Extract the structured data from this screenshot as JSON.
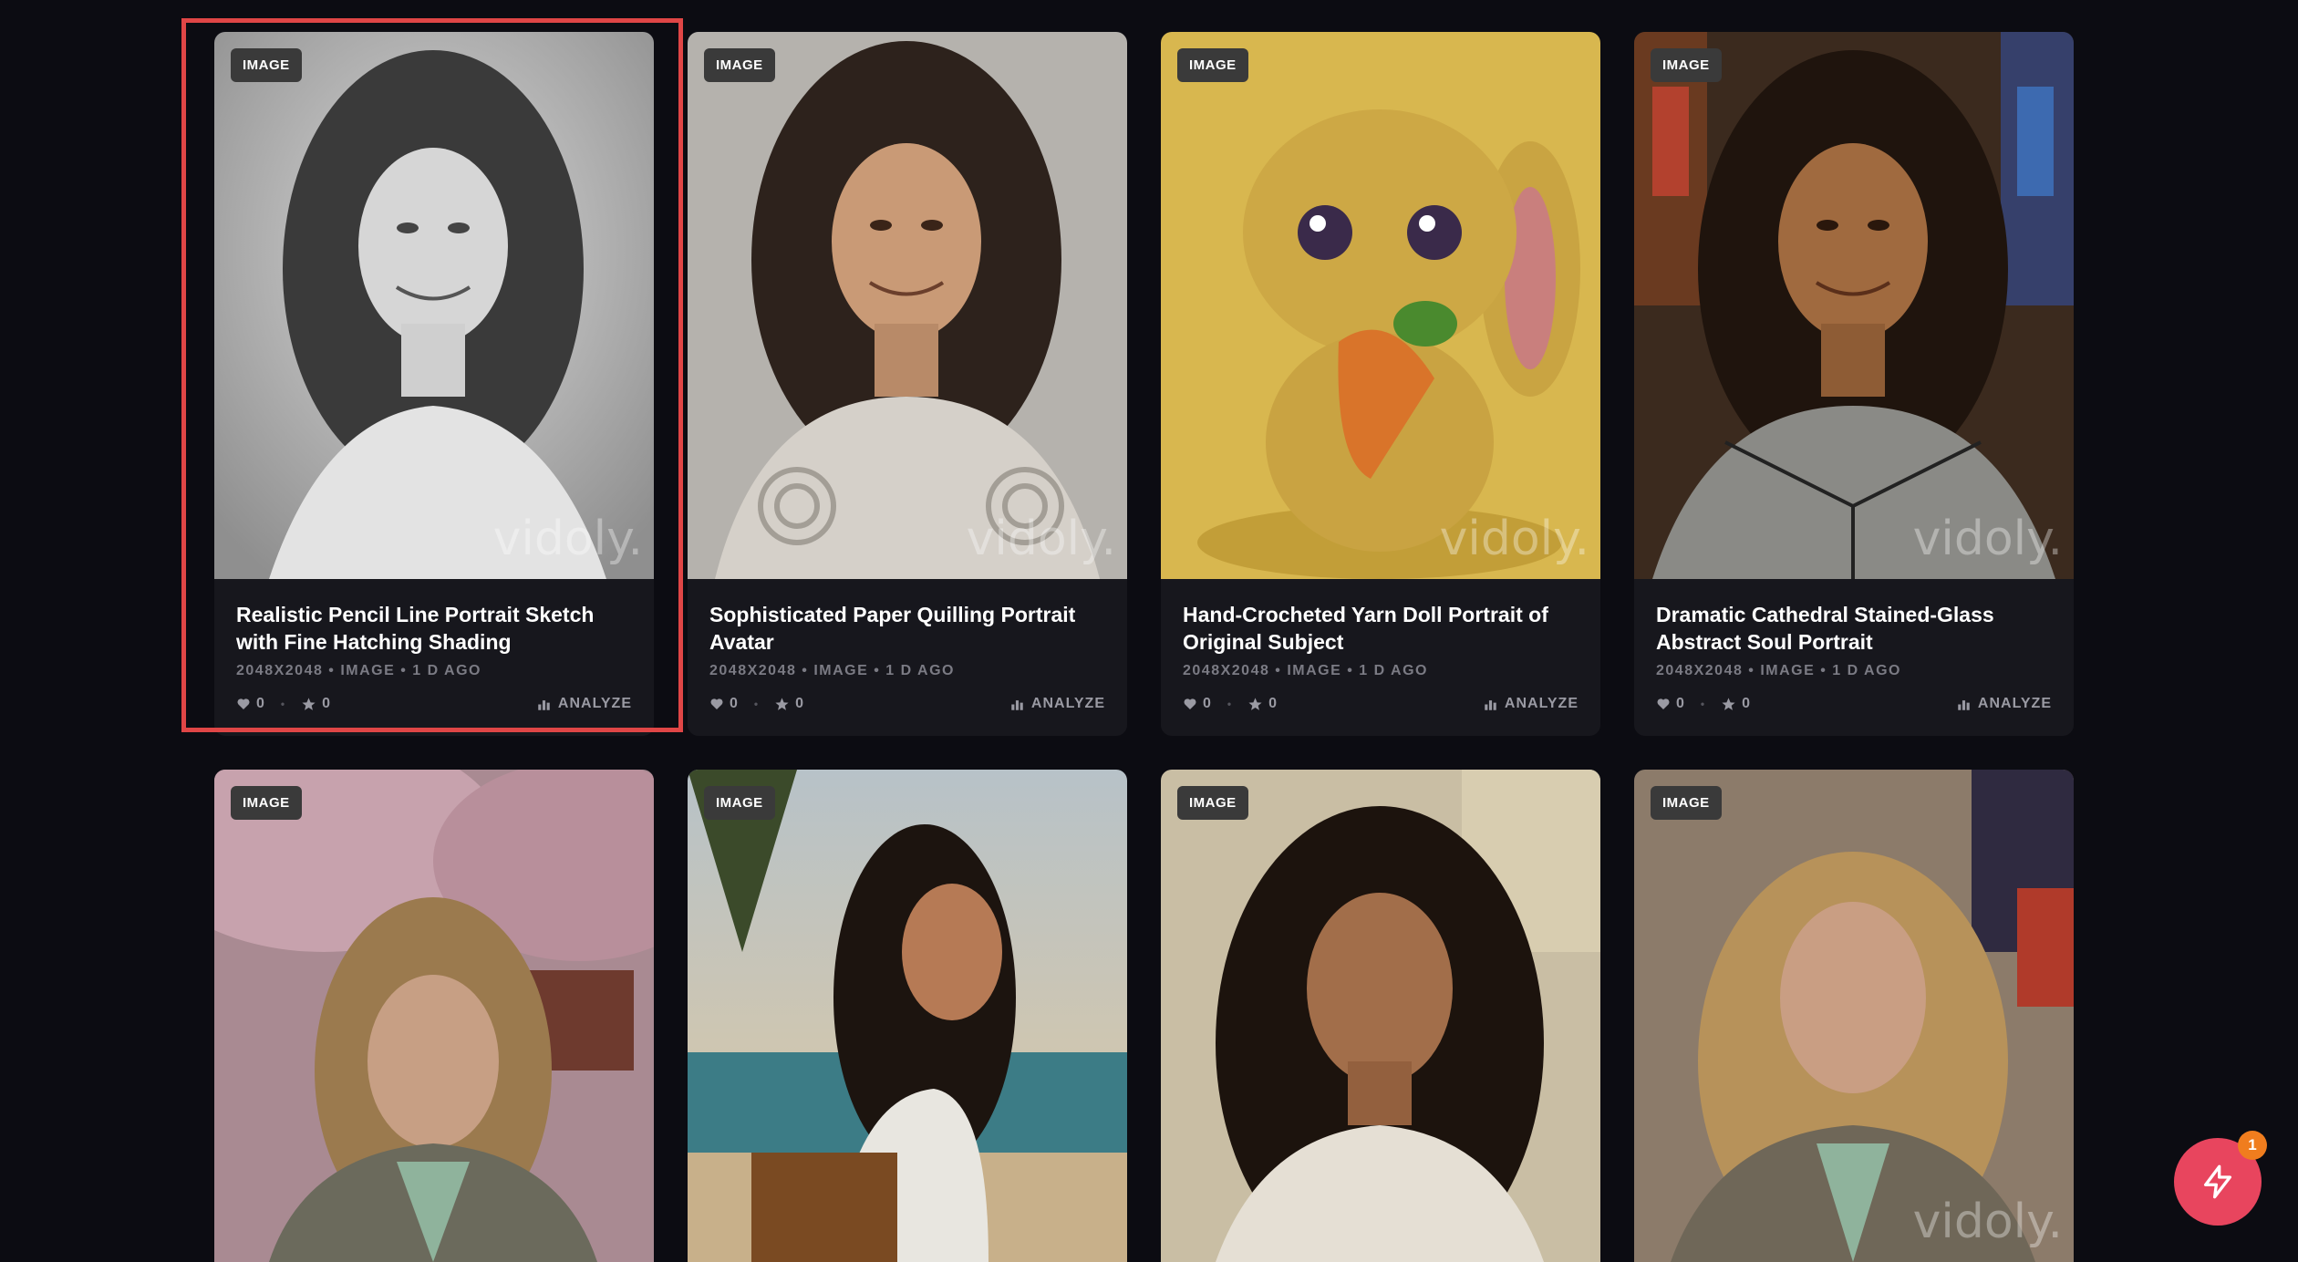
{
  "watermark": "vidoly.",
  "colors": {
    "background": "#0c0c12",
    "card": "#17171d",
    "highlight": "#e04646",
    "fab": "#e8455e",
    "fab_badge": "#f07d1e"
  },
  "cards": [
    {
      "badge": "IMAGE",
      "title": "Realistic Pencil Line Portrait Sketch with Fine Hatching Shading",
      "meta": "2048X2048 • IMAGE • 1 D AGO",
      "likes": "0",
      "stars": "0",
      "analyze": "ANALYZE",
      "theme": "pencil-sketch"
    },
    {
      "badge": "IMAGE",
      "title": "Sophisticated Paper Quilling Portrait Avatar",
      "meta": "2048X2048 • IMAGE • 1 D AGO",
      "likes": "0",
      "stars": "0",
      "analyze": "ANALYZE",
      "theme": "paper-quilling"
    },
    {
      "badge": "IMAGE",
      "title": "Hand-Crocheted Yarn Doll Portrait of Original Subject",
      "meta": "2048X2048 • IMAGE • 1 D AGO",
      "likes": "0",
      "stars": "0",
      "analyze": "ANALYZE",
      "theme": "yarn-bunny"
    },
    {
      "badge": "IMAGE",
      "title": "Dramatic Cathedral Stained-Glass Abstract Soul Portrait",
      "meta": "2048X2048 • IMAGE • 1 D AGO",
      "likes": "0",
      "stars": "0",
      "analyze": "ANALYZE",
      "theme": "stained-glass"
    },
    {
      "badge": "IMAGE",
      "theme": "cherry-blossom"
    },
    {
      "badge": "IMAGE",
      "theme": "beach-sunset"
    },
    {
      "badge": "IMAGE",
      "theme": "oil-painting"
    },
    {
      "badge": "IMAGE",
      "theme": "abstract-painting"
    }
  ],
  "fab": {
    "icon": "lightning-icon",
    "badge_count": "1"
  }
}
